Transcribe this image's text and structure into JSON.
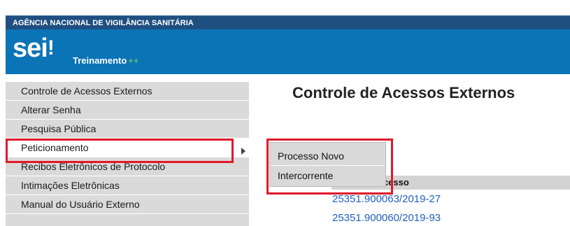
{
  "header": {
    "agency_name": "AGÊNCIA NACIONAL DE VIGILÂNCIA SANITÁRIA",
    "logo_text": "sei",
    "logo_mark": "!",
    "environment_label": "Treinamento",
    "environment_suffix": "++"
  },
  "menu": {
    "items": [
      {
        "label": "Controle de Acessos Externos"
      },
      {
        "label": "Alterar Senha"
      },
      {
        "label": "Pesquisa Pública"
      },
      {
        "label": "Peticionamento"
      },
      {
        "label": "Recibos Eletrônicos de Protocolo"
      },
      {
        "label": "Intimações Eletrônicas"
      },
      {
        "label": "Manual do Usuário Externo"
      }
    ]
  },
  "submenu": {
    "items": [
      {
        "label": "Processo Novo"
      },
      {
        "label": "Intercorrente"
      }
    ]
  },
  "main": {
    "title": "Controle de Acessos Externos",
    "column_header_visible": "ocesso",
    "rows": [
      {
        "process": "25351.900063/2019-27"
      },
      {
        "process": "25351.900060/2019-93"
      }
    ]
  },
  "colors": {
    "agency_bar": "#1f4f80",
    "brand_bar": "#0a74b6",
    "highlight_border": "#e0192a",
    "link": "#1f5fbf"
  }
}
